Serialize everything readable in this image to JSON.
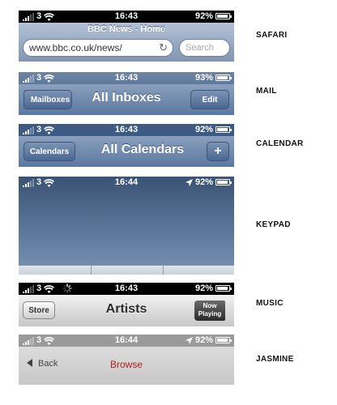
{
  "panels": {
    "safari": {
      "label": "SAFARI",
      "status": {
        "carrier": "3",
        "time": "16:43",
        "battery": "92%"
      },
      "title": "BBC News - Home",
      "url": "www.bbc.co.uk/news/",
      "search_placeholder": "Search"
    },
    "mail": {
      "label": "MAIL",
      "status": {
        "carrier": "3",
        "time": "16:43",
        "battery": "93%"
      },
      "back_label": "Mailboxes",
      "title": "All Inboxes",
      "edit_label": "Edit"
    },
    "calendar": {
      "label": "CALENDAR",
      "status": {
        "carrier": "3",
        "time": "16:43",
        "battery": "92%"
      },
      "back_label": "Calendars",
      "title": "All Calendars",
      "add_label": "+"
    },
    "keypad": {
      "label": "KEYPAD",
      "status": {
        "carrier": "3",
        "time": "16:44",
        "battery": "92%"
      }
    },
    "music": {
      "label": "MUSIC",
      "status": {
        "carrier": "3",
        "time": "16:43",
        "battery": "92%"
      },
      "store_label": "Store",
      "title": "Artists",
      "now_playing_line1": "Now",
      "now_playing_line2": "Playing"
    },
    "jasmine": {
      "label": "JASMINE",
      "status": {
        "carrier": "3",
        "time": "16:44",
        "battery": "92%"
      },
      "back_label": "Back",
      "title": "Browse"
    }
  },
  "colors": {
    "ios_blue_nav": "#6d84a4",
    "jasmine_title": "#b01e1e",
    "status_black": "#000000"
  }
}
